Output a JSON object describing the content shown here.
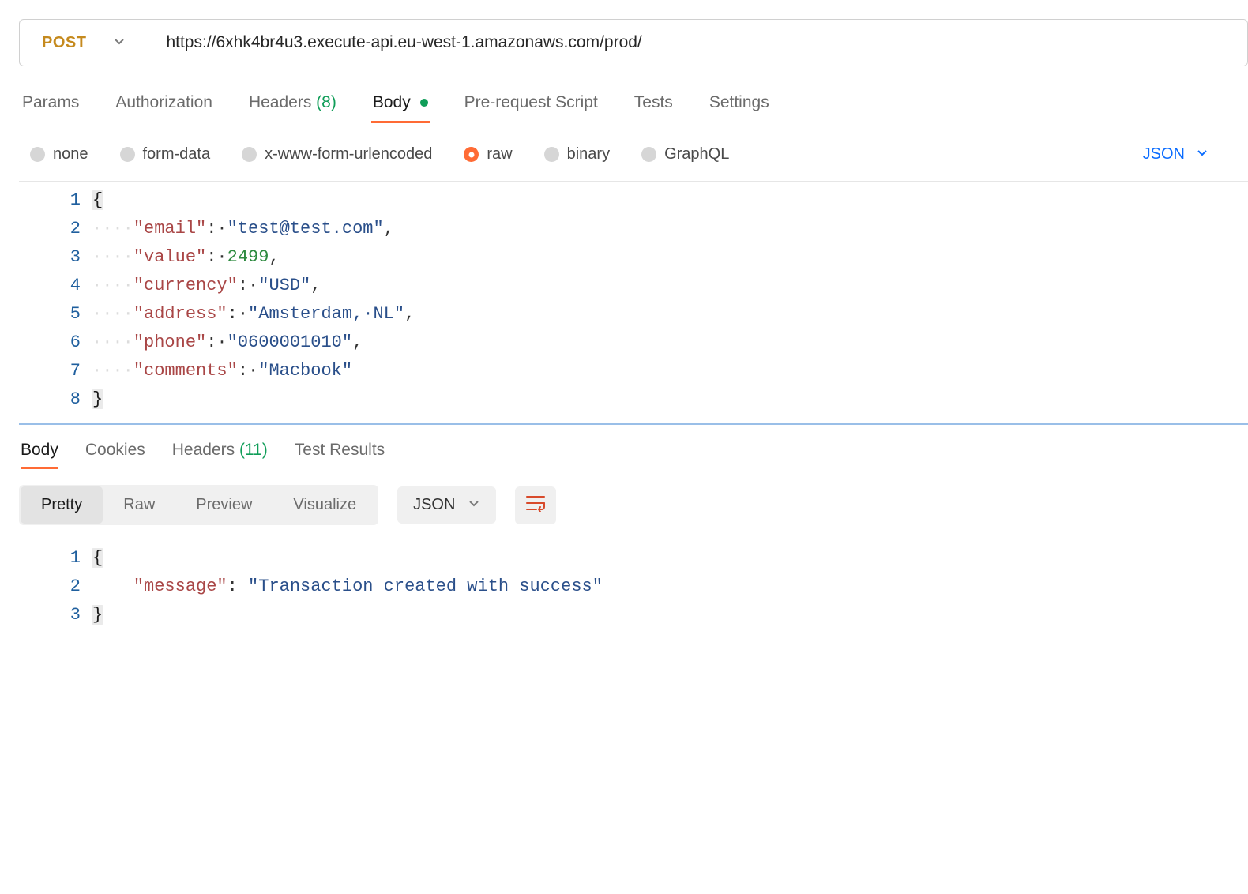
{
  "request": {
    "method": "POST",
    "url": "https://6xhk4br4u3.execute-api.eu-west-1.amazonaws.com/prod/"
  },
  "tabs": {
    "params": "Params",
    "authorization": "Authorization",
    "headers": "Headers",
    "headers_count": "(8)",
    "body": "Body",
    "prerequest": "Pre-request Script",
    "tests": "Tests",
    "settings": "Settings"
  },
  "body_types": {
    "none": "none",
    "form_data": "form-data",
    "urlencoded": "x-www-form-urlencoded",
    "raw": "raw",
    "binary": "binary",
    "graphql": "GraphQL"
  },
  "lang_label": "JSON",
  "request_body": {
    "lines": [
      "1",
      "2",
      "3",
      "4",
      "5",
      "6",
      "7",
      "8"
    ],
    "json": {
      "email_key": "\"email\"",
      "email_val": "\"test@test.com\"",
      "value_key": "\"value\"",
      "value_val": "2499",
      "currency_key": "\"currency\"",
      "currency_val": "\"USD\"",
      "address_key": "\"address\"",
      "address_val": "\"Amsterdam,·NL\"",
      "phone_key": "\"phone\"",
      "phone_val": "\"0600001010\"",
      "comments_key": "\"comments\"",
      "comments_val": "\"Macbook\""
    }
  },
  "response_tabs": {
    "body": "Body",
    "cookies": "Cookies",
    "headers": "Headers",
    "headers_count": "(11)",
    "test_results": "Test Results"
  },
  "view_modes": {
    "pretty": "Pretty",
    "raw": "Raw",
    "preview": "Preview",
    "visualize": "Visualize"
  },
  "resp_lang": "JSON",
  "response_body": {
    "lines": [
      "1",
      "2",
      "3"
    ],
    "message_key": "\"message\"",
    "message_val": "\"Transaction created with success\""
  }
}
